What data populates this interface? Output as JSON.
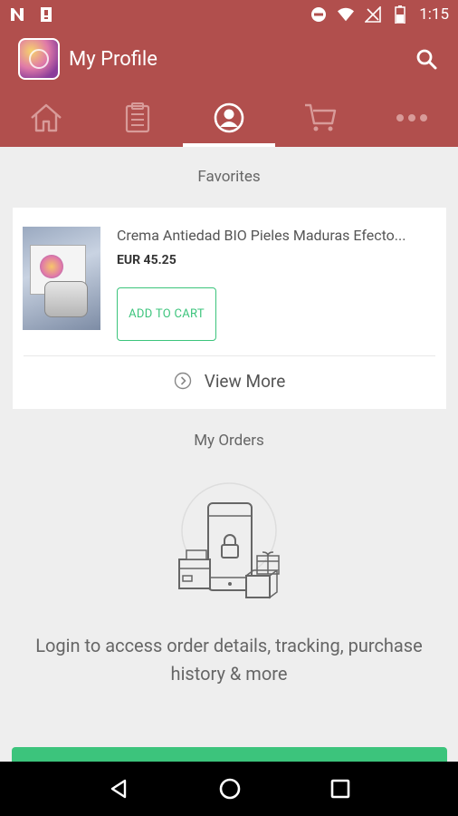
{
  "status_bar": {
    "time": "1:15",
    "icons": [
      "notification-n-icon",
      "clipboard-icon",
      "do-not-disturb-icon",
      "wifi-icon",
      "no-signal-icon",
      "battery-icon"
    ]
  },
  "app_bar": {
    "title": "My Profile",
    "icons": [
      "app-logo",
      "search-icon"
    ]
  },
  "tabs": [
    {
      "name": "home",
      "icon": "home-icon",
      "active": false
    },
    {
      "name": "orders",
      "icon": "clipboard-list-icon",
      "active": false
    },
    {
      "name": "profile",
      "icon": "profile-icon",
      "active": true
    },
    {
      "name": "cart",
      "icon": "cart-icon",
      "active": false
    },
    {
      "name": "more",
      "icon": "more-dots-icon",
      "active": false
    }
  ],
  "favorites": {
    "section_title": "Favorites",
    "product": {
      "name": "Crema Antiedad BIO Pieles Maduras Efecto...",
      "price": "EUR 45.25",
      "add_to_cart_label": "ADD TO CART"
    },
    "view_more_label": "View More"
  },
  "orders": {
    "section_title": "My Orders",
    "login_message": "Login to access order details, tracking, purchase history & more"
  },
  "colors": {
    "primary": "#b14f4d",
    "accent_green": "#3cc47c",
    "background": "#eeeeee"
  },
  "nav_bar": {
    "icons": [
      "back-icon",
      "home-circle-icon",
      "recents-icon"
    ]
  }
}
